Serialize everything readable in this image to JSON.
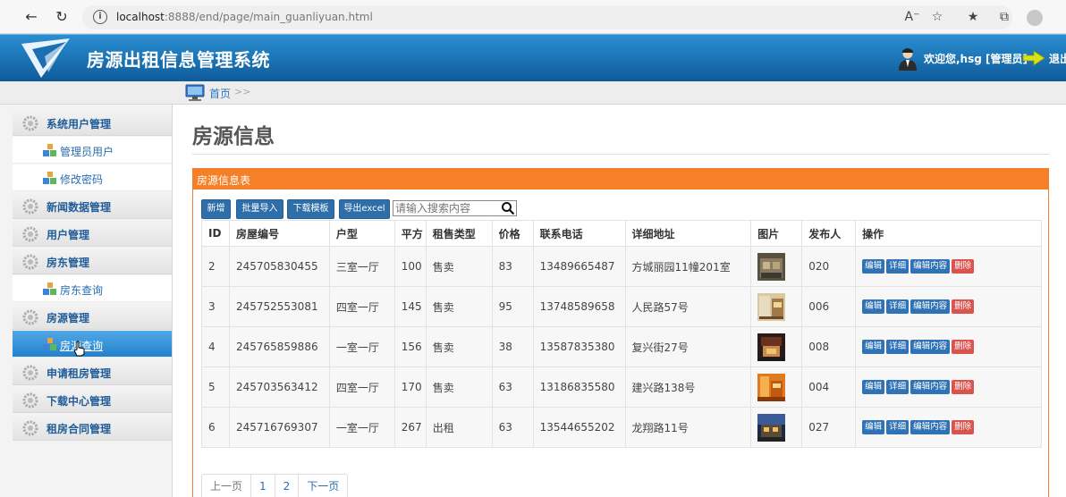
{
  "browser": {
    "url_host": "localhost",
    "url_rest": ":8888/end/page/main_guanliyuan.html"
  },
  "header": {
    "app_title": "房源出租信息管理系统",
    "welcome": "欢迎您,hsg [管理员]",
    "logout": "退出"
  },
  "breadcrumb": {
    "home": "首页",
    "sep": ">>"
  },
  "sidebar": {
    "items": [
      {
        "type": "group",
        "label": "系统用户管理"
      },
      {
        "type": "item",
        "label": "管理员用户"
      },
      {
        "type": "item",
        "label": "修改密码"
      },
      {
        "type": "group",
        "label": "新闻数据管理"
      },
      {
        "type": "group",
        "label": "用户管理"
      },
      {
        "type": "group",
        "label": "房东管理"
      },
      {
        "type": "item",
        "label": "房东查询"
      },
      {
        "type": "group",
        "label": "房源管理"
      },
      {
        "type": "item",
        "label": "房源查询",
        "active": true
      },
      {
        "type": "group",
        "label": "申请租房管理"
      },
      {
        "type": "group",
        "label": "下载中心管理"
      },
      {
        "type": "group",
        "label": "租房合同管理"
      }
    ]
  },
  "main": {
    "title": "房源信息",
    "panel_title": "房源信息表",
    "toolbar": {
      "add": "新增",
      "batch_import": "批量导入",
      "download_template": "下载模板",
      "export_excel": "导出excel",
      "search_placeholder": "请输入搜索内容"
    },
    "columns": [
      "ID",
      "房屋编号",
      "户型",
      "平方",
      "租售类型",
      "价格",
      "联系电话",
      "详细地址",
      "图片",
      "发布人",
      "操作"
    ],
    "rows": [
      {
        "id": "2",
        "code": "245705830455",
        "layout": "三室一厅",
        "area": "100",
        "type": "售卖",
        "price": "83",
        "phone": "13489665487",
        "address": "方城丽园11幢201室",
        "publisher": "020"
      },
      {
        "id": "3",
        "code": "245752553081",
        "layout": "四室一厅",
        "area": "145",
        "type": "售卖",
        "price": "95",
        "phone": "13748589658",
        "address": "人民路57号",
        "publisher": "006"
      },
      {
        "id": "4",
        "code": "245765859886",
        "layout": "一室一厅",
        "area": "156",
        "type": "售卖",
        "price": "38",
        "phone": "13587835380",
        "address": "复兴街27号",
        "publisher": "008"
      },
      {
        "id": "5",
        "code": "245703563412",
        "layout": "四室一厅",
        "area": "170",
        "type": "售卖",
        "price": "63",
        "phone": "13186835580",
        "address": "建兴路138号",
        "publisher": "004"
      },
      {
        "id": "6",
        "code": "245716769307",
        "layout": "一室一厅",
        "area": "267",
        "type": "出租",
        "price": "63",
        "phone": "13544655202",
        "address": "龙翔路11号",
        "publisher": "027"
      }
    ],
    "row_actions": {
      "edit": "编辑",
      "detail": "详细",
      "edit_content": "编辑内容",
      "delete": "删除"
    },
    "pager": {
      "prev": "上一页",
      "pages": [
        "1",
        "2"
      ],
      "next": "下一页"
    }
  },
  "colors": {
    "header_blue": "#1a73bd",
    "panel_orange": "#f58028",
    "button_blue": "#2e6ea9",
    "delete_red": "#d9534f"
  }
}
